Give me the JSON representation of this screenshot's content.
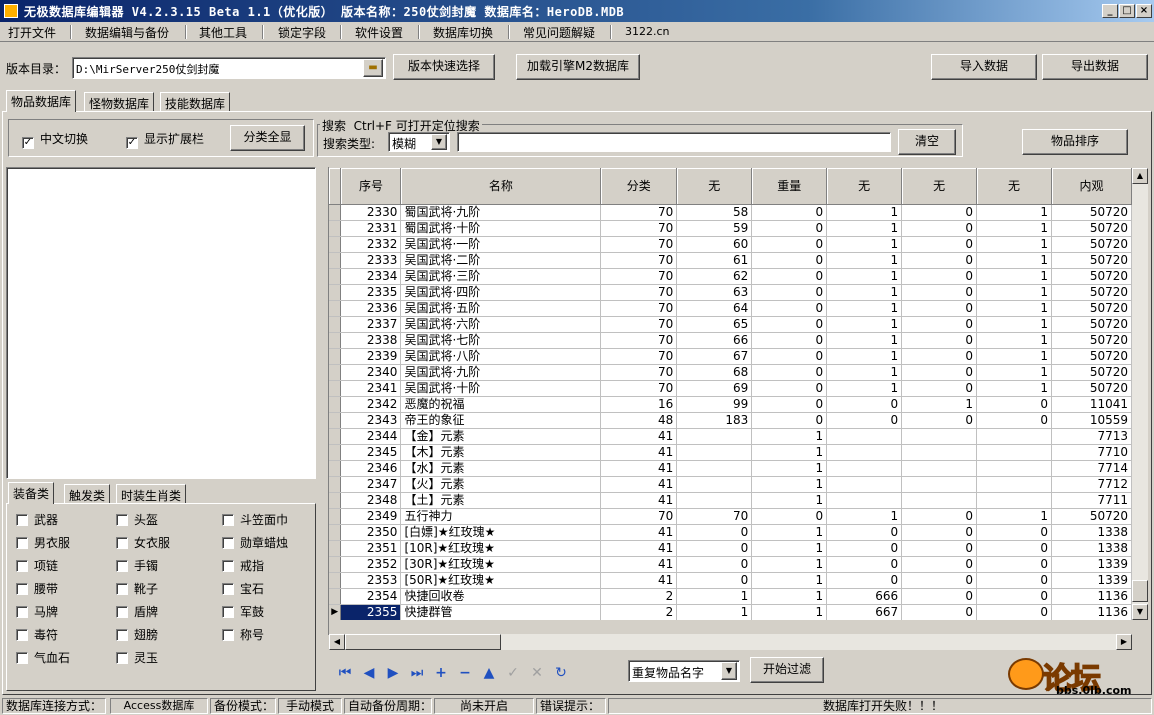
{
  "window": {
    "title": "无极数据库编辑器 V4.2.3.15   Beta 1.1（优化版）   版本名称：250仗剑封魔    数据库名：HeroDB.MDB"
  },
  "menu": [
    "打开文件",
    "数据编辑与备份",
    "其他工具",
    "锁定字段",
    "软件设置",
    "数据库切换",
    "常见问题解疑",
    "3122.cn"
  ],
  "toolbar": {
    "version_dir_label": "版本目录：",
    "version_dir_value": "D:\\MirServer250仗剑封魔",
    "quick_select": "版本快速选择",
    "load_m2": "加载引擎M2数据库",
    "import": "导入数据",
    "export": "导出数据"
  },
  "tabs": [
    "物品数据库",
    "怪物数据库",
    "技能数据库"
  ],
  "options": {
    "chinese_toggle": "中文切换",
    "show_extension": "显示扩展栏",
    "show_all_categories": "分类全显"
  },
  "search": {
    "group_title": "搜索  Ctrl+F 可打开定位搜索",
    "type_label": "搜索类型:",
    "type_value": "模糊",
    "query": "",
    "clear": "清空",
    "sort": "物品排序"
  },
  "category_tabs": [
    "装备类",
    "触发类",
    "时装生肖类"
  ],
  "categories": [
    [
      "武器",
      "头盔",
      "斗笠面巾"
    ],
    [
      "男衣服",
      "女衣服",
      "勋章蜡烛"
    ],
    [
      "项链",
      "手镯",
      "戒指"
    ],
    [
      "腰带",
      "靴子",
      "宝石"
    ],
    [
      "马牌",
      "盾牌",
      "军鼓"
    ],
    [
      "毒符",
      "翅膀",
      "称号"
    ],
    [
      "气血石",
      "灵玉",
      ""
    ]
  ],
  "grid": {
    "columns": [
      "序号",
      "名称",
      "分类",
      "无",
      "重量",
      "无",
      "无",
      "无",
      "内观"
    ],
    "rows": [
      [
        "2330",
        "蜀国武将·九阶",
        "70",
        "58",
        "0",
        "1",
        "0",
        "1",
        "50720"
      ],
      [
        "2331",
        "蜀国武将·十阶",
        "70",
        "59",
        "0",
        "1",
        "0",
        "1",
        "50720"
      ],
      [
        "2332",
        "吴国武将·一阶",
        "70",
        "60",
        "0",
        "1",
        "0",
        "1",
        "50720"
      ],
      [
        "2333",
        "吴国武将·二阶",
        "70",
        "61",
        "0",
        "1",
        "0",
        "1",
        "50720"
      ],
      [
        "2334",
        "吴国武将·三阶",
        "70",
        "62",
        "0",
        "1",
        "0",
        "1",
        "50720"
      ],
      [
        "2335",
        "吴国武将·四阶",
        "70",
        "63",
        "0",
        "1",
        "0",
        "1",
        "50720"
      ],
      [
        "2336",
        "吴国武将·五阶",
        "70",
        "64",
        "0",
        "1",
        "0",
        "1",
        "50720"
      ],
      [
        "2337",
        "吴国武将·六阶",
        "70",
        "65",
        "0",
        "1",
        "0",
        "1",
        "50720"
      ],
      [
        "2338",
        "吴国武将·七阶",
        "70",
        "66",
        "0",
        "1",
        "0",
        "1",
        "50720"
      ],
      [
        "2339",
        "吴国武将·八阶",
        "70",
        "67",
        "0",
        "1",
        "0",
        "1",
        "50720"
      ],
      [
        "2340",
        "吴国武将·九阶",
        "70",
        "68",
        "0",
        "1",
        "0",
        "1",
        "50720"
      ],
      [
        "2341",
        "吴国武将·十阶",
        "70",
        "69",
        "0",
        "1",
        "0",
        "1",
        "50720"
      ],
      [
        "2342",
        "恶魔的祝福",
        "16",
        "99",
        "0",
        "0",
        "1",
        "0",
        "11041"
      ],
      [
        "2343",
        "帝王的象征",
        "48",
        "183",
        "0",
        "0",
        "0",
        "0",
        "10559"
      ],
      [
        "2344",
        "【金】元素",
        "41",
        "",
        "1",
        "",
        "",
        "",
        "7713"
      ],
      [
        "2345",
        "【木】元素",
        "41",
        "",
        "1",
        "",
        "",
        "",
        "7710"
      ],
      [
        "2346",
        "【水】元素",
        "41",
        "",
        "1",
        "",
        "",
        "",
        "7714"
      ],
      [
        "2347",
        "【火】元素",
        "41",
        "",
        "1",
        "",
        "",
        "",
        "7712"
      ],
      [
        "2348",
        "【土】元素",
        "41",
        "",
        "1",
        "",
        "",
        "",
        "7711"
      ],
      [
        "2349",
        "五行神力",
        "70",
        "70",
        "0",
        "1",
        "0",
        "1",
        "50720"
      ],
      [
        "2350",
        "[白嫖]★红玫瑰★",
        "41",
        "0",
        "1",
        "0",
        "0",
        "0",
        "1338"
      ],
      [
        "2351",
        "[10R]★红玫瑰★",
        "41",
        "0",
        "1",
        "0",
        "0",
        "0",
        "1338"
      ],
      [
        "2352",
        "[30R]★红玫瑰★",
        "41",
        "0",
        "1",
        "0",
        "0",
        "0",
        "1339"
      ],
      [
        "2353",
        "[50R]★红玫瑰★",
        "41",
        "0",
        "1",
        "0",
        "0",
        "0",
        "1339"
      ],
      [
        "2354",
        "快捷回收卷",
        "2",
        "1",
        "1",
        "666",
        "0",
        "0",
        "1136"
      ],
      [
        "2355",
        "快捷群管",
        "2",
        "1",
        "1",
        "667",
        "0",
        "0",
        "1136"
      ]
    ],
    "selected_row": "2355"
  },
  "filter": {
    "field_value": "重复物品名字",
    "start_filter": "开始过滤"
  },
  "status": {
    "conn_label": "数据库连接方式：",
    "conn_value": "Access数据库",
    "backup_label": "备份模式：",
    "backup_value": "手动模式",
    "auto_label": "自动备份周期：",
    "auto_value": "尚未开启",
    "error_label": "错误提示：",
    "error_value": "数据库打开失败！！！"
  },
  "watermark": {
    "text": "论坛",
    "domain": "bbs.0lb.com"
  }
}
